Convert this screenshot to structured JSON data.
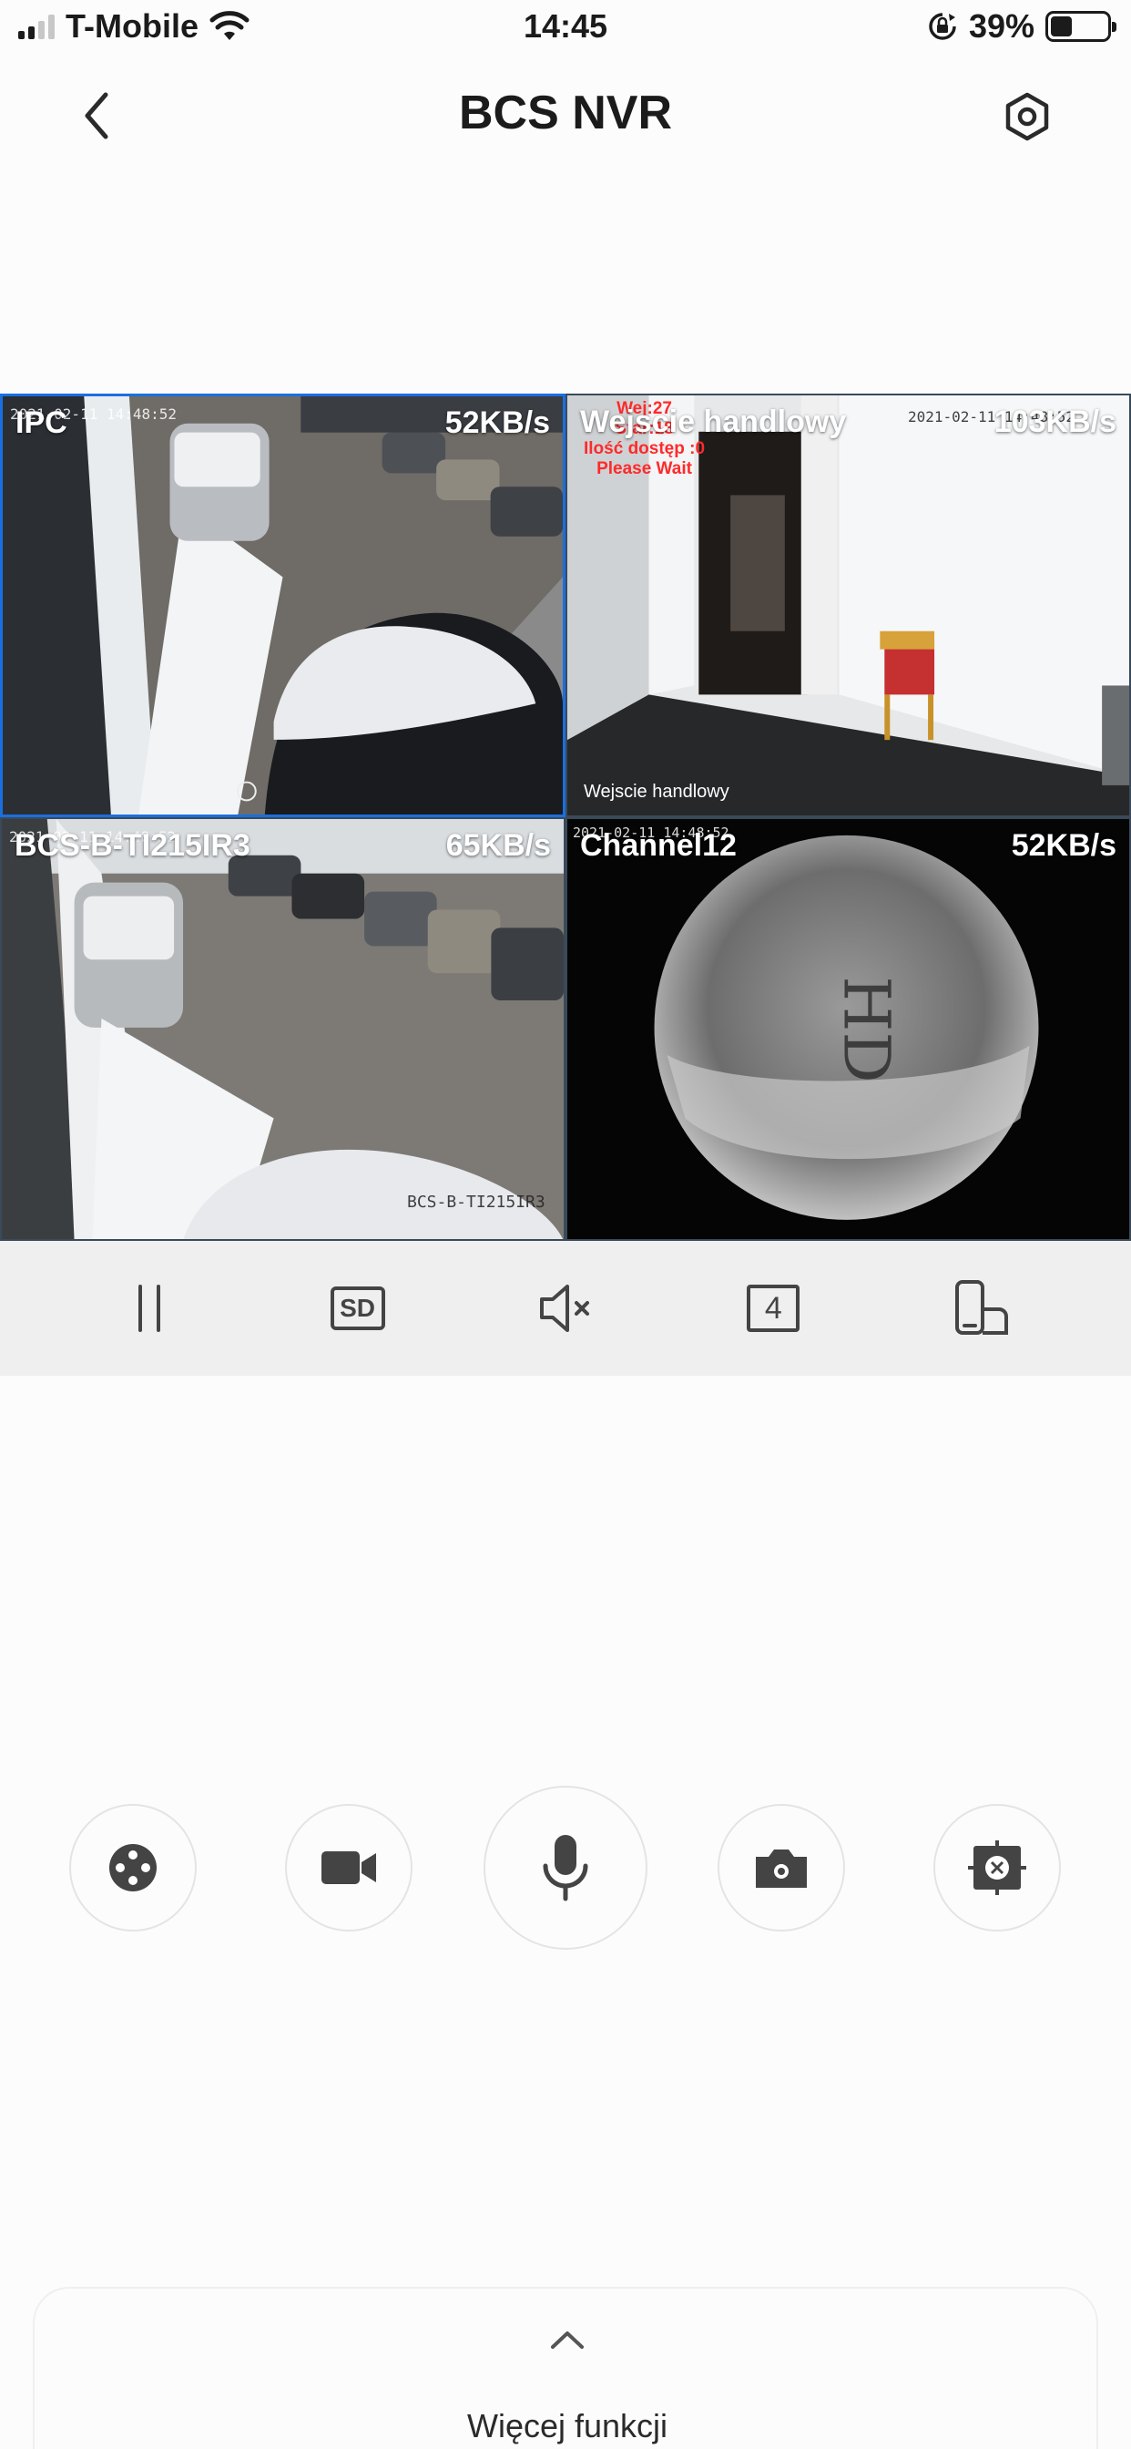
{
  "status_bar": {
    "carrier": "T-Mobile",
    "time": "14:45",
    "battery": "39%",
    "battery_level": 0.39
  },
  "header": {
    "title": "BCS NVR"
  },
  "cameras": [
    {
      "name": "IPC",
      "rate": "52KB/s",
      "osd": "2021-02-11 14:48:52",
      "selected": true
    },
    {
      "name": "Wejscie handlowy",
      "rate": "103KB/s",
      "osd": "2021-02-11 14:48:52",
      "caption": "Wejscie handlowy",
      "overlay": [
        "Wej:27",
        "Star:18",
        "Ilość dostęp :0",
        "Please Wait"
      ]
    },
    {
      "name": "BCS-B-TI215IR3",
      "rate": "65KB/s",
      "osd": "2021-02-11 14:48:52",
      "watermark": "BCS-B-TI215IR3"
    },
    {
      "name": "Channel12",
      "rate": "52KB/s",
      "osd": "2021-02-11 14:48:52",
      "lens_text": "HD"
    }
  ],
  "toolbar": {
    "quality": "SD",
    "split_count": "4"
  },
  "more_functions": {
    "label": "Więcej funkcji"
  },
  "colors": {
    "accent": "#1a6fe0",
    "toolbar_bg": "#efefef",
    "icon": "#444444"
  }
}
